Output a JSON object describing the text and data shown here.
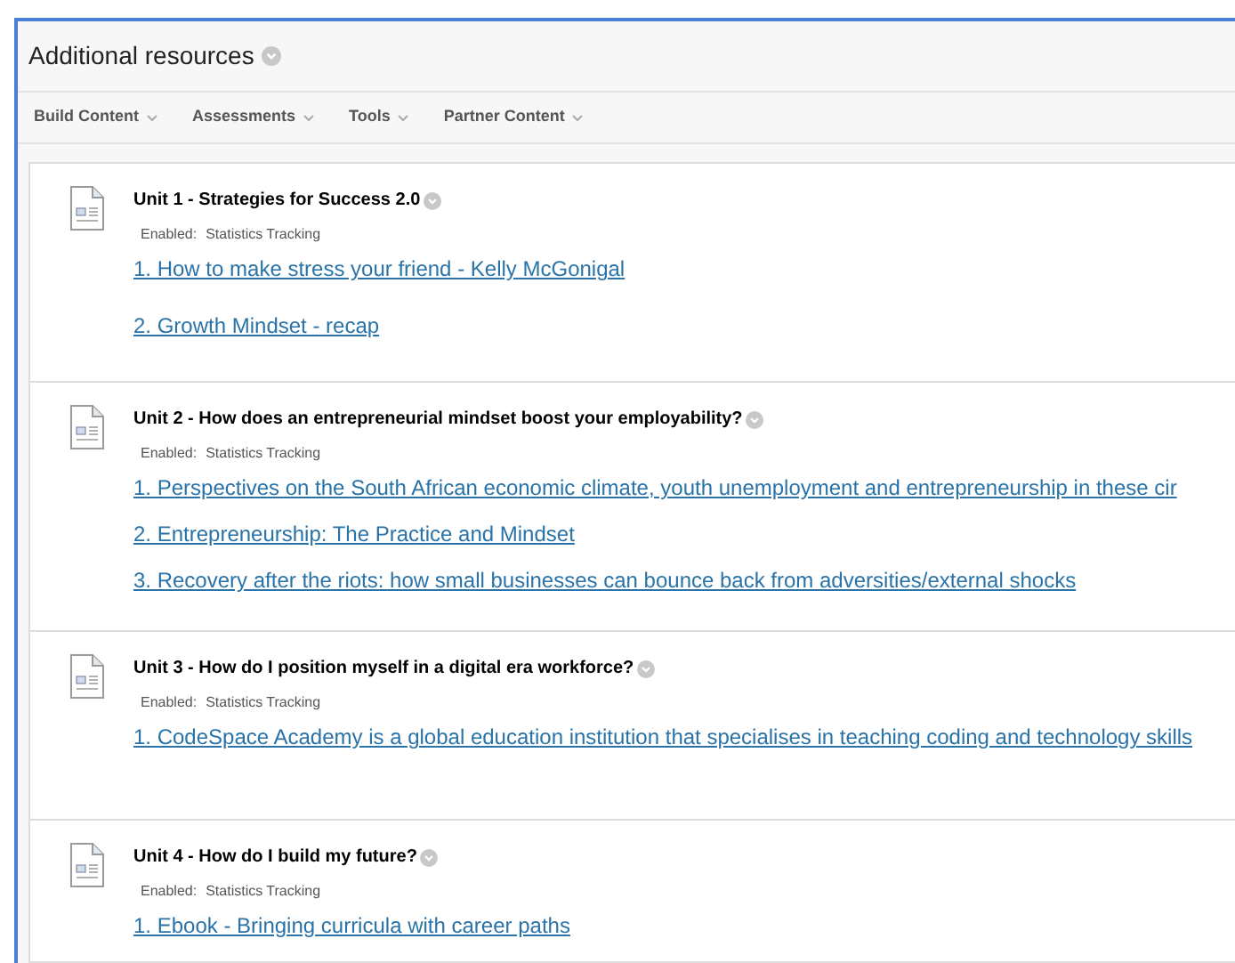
{
  "page": {
    "title": "Additional resources"
  },
  "toolbar": [
    {
      "label": "Build Content"
    },
    {
      "label": "Assessments"
    },
    {
      "label": "Tools"
    },
    {
      "label": "Partner Content"
    }
  ],
  "items": [
    {
      "title": "Unit 1 - Strategies for Success 2.0",
      "enabled_label": "Enabled:",
      "tracking": "Statistics Tracking",
      "links": [
        "1. How to make stress your friend - Kelly McGonigal",
        "2. Growth Mindset - recap"
      ]
    },
    {
      "title": "Unit 2 - How does an entrepreneurial mindset boost your employability?",
      "enabled_label": "Enabled:",
      "tracking": "Statistics Tracking",
      "links": [
        "1. Perspectives on the South African economic climate, youth unemployment and entrepreneurship in these cir",
        "2. Entrepreneurship: The Practice and Mindset",
        "3. Recovery after the riots: how small businesses can bounce back from adversities/external shocks"
      ]
    },
    {
      "title": "Unit 3 - How do I position myself in a digital era workforce?",
      "enabled_label": "Enabled:",
      "tracking": "Statistics Tracking",
      "links": [
        "1. CodeSpace Academy is a global education institution that specialises in teaching coding and technology skills"
      ]
    },
    {
      "title": "Unit 4 - How do I build my future?",
      "enabled_label": "Enabled:",
      "tracking": "Statistics Tracking",
      "links": [
        "1. Ebook - Bringing curricula with career paths"
      ]
    }
  ]
}
